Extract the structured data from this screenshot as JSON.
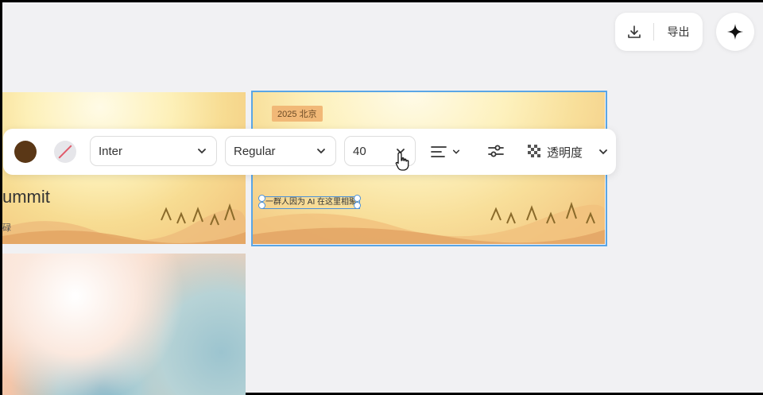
{
  "header": {
    "export_label": "导出",
    "download_icon": "download-icon",
    "ai_icon": "sparkle-icon"
  },
  "canvas": {
    "slide_a": {
      "title_partial": "ummit",
      "subtitle_partial": "碌"
    },
    "slide_b": {
      "tag": "2025 北京",
      "selected_text": "一群人因为 AI 在这里相聚"
    }
  },
  "toolbar": {
    "text_color": "#5a3716",
    "font_family": "Inter",
    "font_weight": "Regular",
    "font_size": "40",
    "opacity_label": "透明度"
  },
  "colors": {
    "selection": "#4a90d9",
    "tag_bg": "#f1b877"
  }
}
